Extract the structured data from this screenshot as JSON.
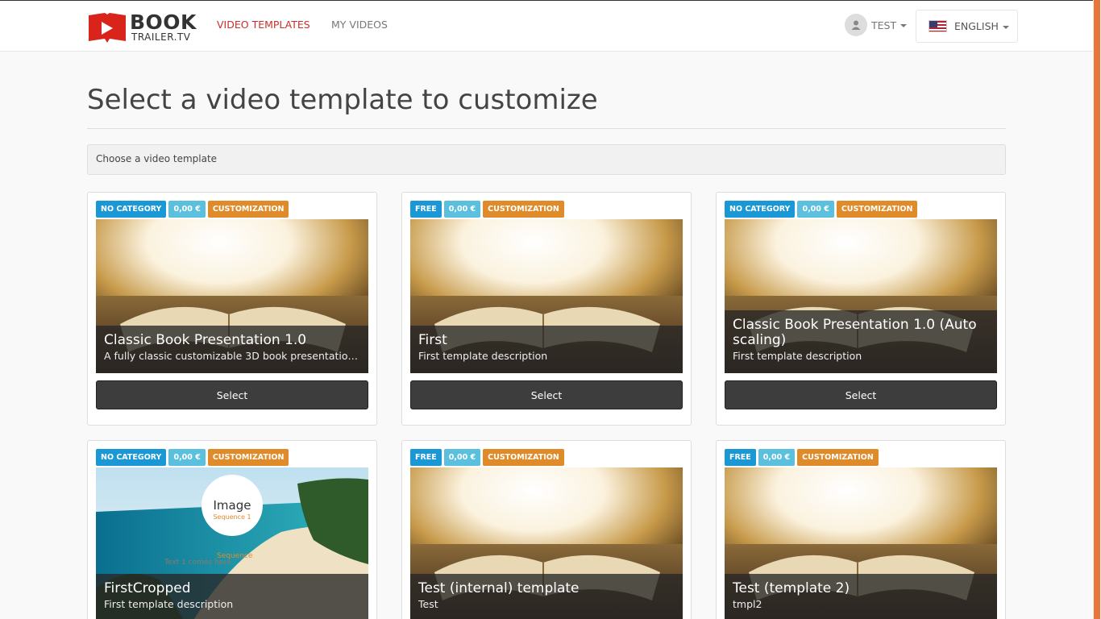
{
  "navbar": {
    "logo_top": "BOOK",
    "logo_bottom": "TRAILER.TV",
    "links": [
      "VIDEO TEMPLATES",
      "MY VIDEOS"
    ],
    "user_label": "TEST",
    "language_label": "ENGLISH",
    "accent": "#c9302c"
  },
  "page": {
    "title": "Select a video template to customize",
    "filter_text": "Choose a video template"
  },
  "cards": [
    {
      "badges": [
        "NO CATEGORY",
        "0,00 €",
        "CUSTOMIZATION"
      ],
      "title": "Classic Book Presentation 1.0",
      "description": "A fully classic customizable 3D book presentation...",
      "button": "Select",
      "image": "open-book"
    },
    {
      "badges": [
        "FREE",
        "0,00 €",
        "CUSTOMIZATION"
      ],
      "title": "First",
      "description": "First template description",
      "button": "Select",
      "image": "open-book"
    },
    {
      "badges": [
        "NO CATEGORY",
        "0,00 €",
        "CUSTOMIZATION"
      ],
      "title": "Classic Book Presentation 1.0 (Auto scaling)",
      "description": "First template description",
      "button": "Select",
      "image": "open-book"
    },
    {
      "badges": [
        "NO CATEGORY",
        "0,00 €",
        "CUSTOMIZATION"
      ],
      "title": "FirstCropped",
      "description": "First template description",
      "button": "Select",
      "image": "beach",
      "overlay_title": "Image",
      "overlay_sub": "Sequence 1",
      "overlay_seq": "Sequence",
      "overlay_text": "Text 1 comes here"
    },
    {
      "badges": [
        "FREE",
        "0,00 €",
        "CUSTOMIZATION"
      ],
      "title": "Test (internal) template",
      "description": "Test",
      "button": "Select",
      "image": "open-book"
    },
    {
      "badges": [
        "FREE",
        "0,00 €",
        "CUSTOMIZATION"
      ],
      "title": "Test (template 2)",
      "description": "tmpl2",
      "button": "Select",
      "image": "open-book"
    }
  ]
}
